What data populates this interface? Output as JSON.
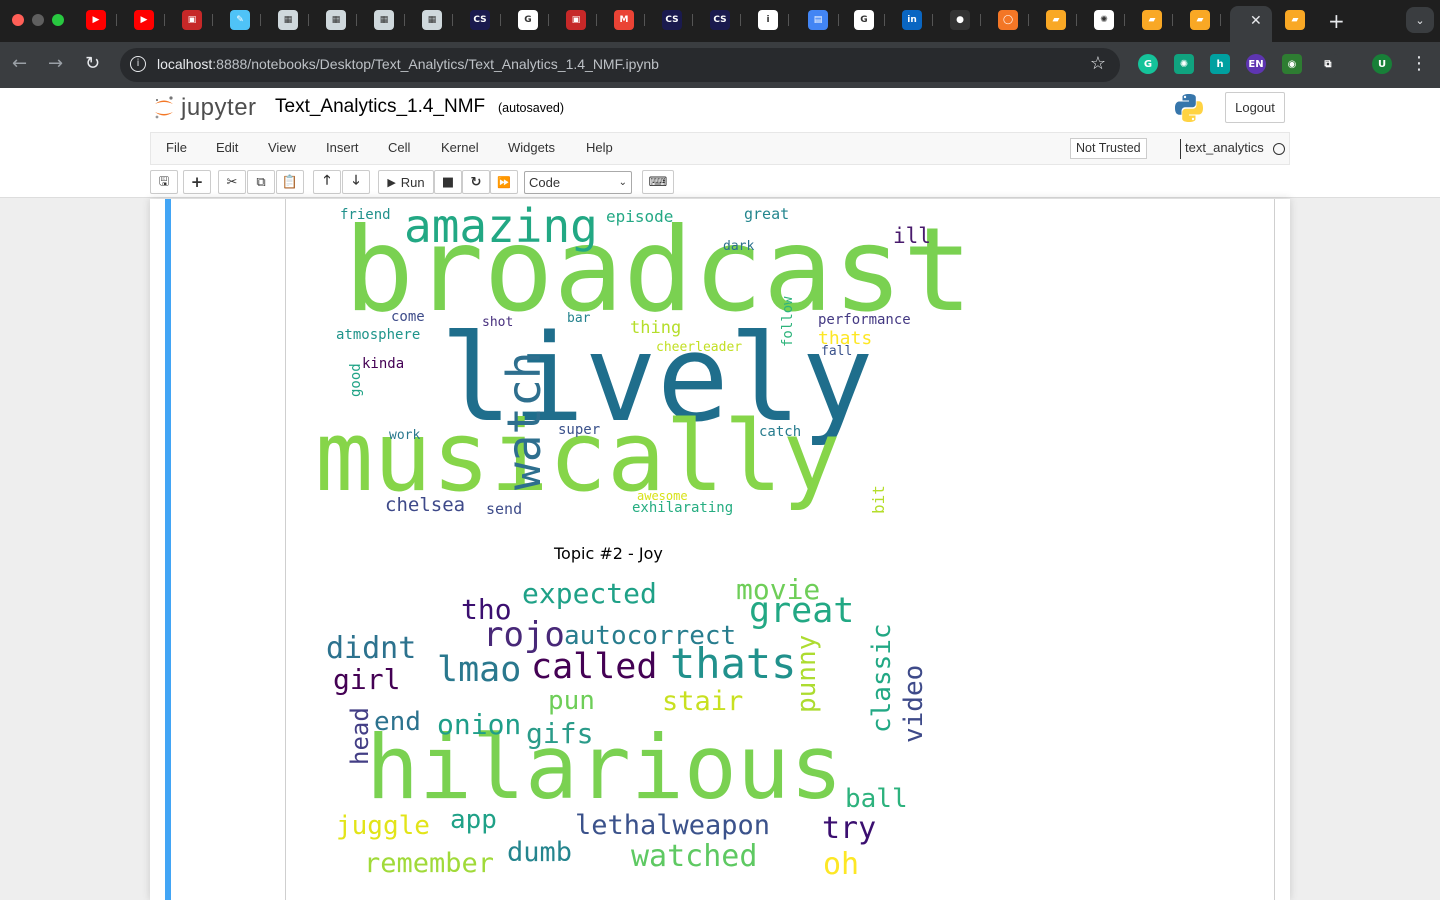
{
  "browser": {
    "tabs": [
      {
        "icon": "youtube-icon",
        "color": "#ff0000",
        "text": "▶"
      },
      {
        "icon": "youtube-icon",
        "color": "#ff0000",
        "text": "▶"
      },
      {
        "icon": "pdf-icon",
        "color": "#c62828",
        "text": "▣"
      },
      {
        "icon": "feather-icon",
        "color": "#4fc3f7",
        "text": "✎"
      },
      {
        "icon": "news-icon",
        "color": "#cfd8dc",
        "text": "▦"
      },
      {
        "icon": "news-icon",
        "color": "#cfd8dc",
        "text": "▦"
      },
      {
        "icon": "news-icon",
        "color": "#cfd8dc",
        "text": "▦"
      },
      {
        "icon": "news-icon",
        "color": "#cfd8dc",
        "text": "▦"
      },
      {
        "icon": "cs-icon",
        "color": "#1a1a4e",
        "text": "CS"
      },
      {
        "icon": "google-icon",
        "color": "#ffffff",
        "text": "G"
      },
      {
        "icon": "pdf-icon",
        "color": "#c62828",
        "text": "▣"
      },
      {
        "icon": "gmail-icon",
        "color": "#ea4335",
        "text": "M"
      },
      {
        "icon": "cs-icon",
        "color": "#1a1a4e",
        "text": "CS"
      },
      {
        "icon": "cs-icon",
        "color": "#1a1a4e",
        "text": "CS"
      },
      {
        "icon": "info-icon",
        "color": "#ffffff",
        "text": "i"
      },
      {
        "icon": "calendar-icon",
        "color": "#4285f4",
        "text": "▤"
      },
      {
        "icon": "google-icon",
        "color": "#ffffff",
        "text": "G"
      },
      {
        "icon": "linkedin-icon",
        "color": "#0a66c2",
        "text": "in"
      },
      {
        "icon": "github-icon",
        "color": "#333333",
        "text": "●"
      },
      {
        "icon": "jupyter-icon",
        "color": "#f37626",
        "text": "◯"
      },
      {
        "icon": "book-icon",
        "color": "#f9a825",
        "text": "▰"
      },
      {
        "icon": "chatgpt-icon",
        "color": "#ffffff",
        "text": "✺"
      },
      {
        "icon": "book-icon",
        "color": "#f9a825",
        "text": "▰"
      },
      {
        "icon": "book-icon",
        "color": "#f9a825",
        "text": "▰"
      },
      {
        "icon": "book-icon",
        "color": "#f9a825",
        "text": "▰"
      }
    ],
    "url_host": "localhost",
    "url_rest": ":8888/notebooks/Desktop/Text_Analytics/Text_Analytics_1.4_NMF.ipynb",
    "extensions": [
      {
        "icon": "grammarly-icon",
        "color": "#15c39a",
        "text": "G"
      },
      {
        "icon": "chatgpt-ext-icon",
        "color": "#10a37f",
        "text": "✺"
      },
      {
        "icon": "honey-icon",
        "color": "#00a0a0",
        "text": "h"
      },
      {
        "icon": "translate-icon",
        "color": "#5e35b1",
        "text": "EN"
      },
      {
        "icon": "game-icon",
        "color": "#2e7d32",
        "text": "◉"
      },
      {
        "icon": "puzzle-icon",
        "color": "#3a3d40",
        "text": "⧉"
      }
    ],
    "profile_initial": "U"
  },
  "jupyter": {
    "logo_text": "jupyter",
    "notebook_name": "Text_Analytics_1.4_NMF",
    "autosave_status": "(autosaved)",
    "logout_label": "Logout",
    "menu": [
      "File",
      "Edit",
      "View",
      "Insert",
      "Cell",
      "Kernel",
      "Widgets",
      "Help"
    ],
    "trust_label": "Not Trusted",
    "kernel_name": "text_analytics",
    "run_label": "Run",
    "cell_type": "Code"
  },
  "chart_data": [
    {
      "type": "wordcloud",
      "title": "",
      "words": [
        {
          "text": "broadcast",
          "color": "#7ad151",
          "size": 120
        },
        {
          "text": "lively",
          "color": "#1f6e8c",
          "size": 120
        },
        {
          "text": "musically",
          "color": "#86d549",
          "size": 100
        },
        {
          "text": "amazing",
          "color": "#22a884",
          "size": 48
        },
        {
          "text": "watch",
          "color": "#2e6f8e",
          "size": 46
        },
        {
          "text": "ill",
          "color": "#481a6c",
          "size": 22
        },
        {
          "text": "friend",
          "color": "#21918c",
          "size": 14
        },
        {
          "text": "episode",
          "color": "#23a884",
          "size": 16
        },
        {
          "text": "great",
          "color": "#24868e",
          "size": 15
        },
        {
          "text": "dark",
          "color": "#2d708e",
          "size": 13
        },
        {
          "text": "come",
          "color": "#3e4c8a",
          "size": 14
        },
        {
          "text": "shot",
          "color": "#472f7d",
          "size": 13
        },
        {
          "text": "bar",
          "color": "#25838e",
          "size": 13
        },
        {
          "text": "thing",
          "color": "#b5de2b",
          "size": 16
        },
        {
          "text": "follow",
          "color": "#2fb47c",
          "size": 14
        },
        {
          "text": "performance",
          "color": "#443983",
          "size": 14
        },
        {
          "text": "atmosphere",
          "color": "#1f958b",
          "size": 14
        },
        {
          "text": "cheerleader",
          "color": "#c2df23",
          "size": 13
        },
        {
          "text": "thats",
          "color": "#fde725",
          "size": 18
        },
        {
          "text": "fall",
          "color": "#3b528b",
          "size": 13
        },
        {
          "text": "kinda",
          "color": "#440154",
          "size": 14
        },
        {
          "text": "good",
          "color": "#20a386",
          "size": 14
        },
        {
          "text": "work",
          "color": "#2a788e",
          "size": 13
        },
        {
          "text": "super",
          "color": "#3b528b",
          "size": 14
        },
        {
          "text": "catch",
          "color": "#287c8e",
          "size": 14
        },
        {
          "text": "chelsea",
          "color": "#3e4989",
          "size": 18
        },
        {
          "text": "send",
          "color": "#3e4c8a",
          "size": 15
        },
        {
          "text": "awesome",
          "color": "#d8e219",
          "size": 12
        },
        {
          "text": "exhilarating",
          "color": "#26ad81",
          "size": 14
        },
        {
          "text": "bit",
          "color": "#b5de2b",
          "size": 16
        }
      ]
    },
    {
      "type": "wordcloud",
      "title": "Topic #2 - Joy",
      "words": [
        {
          "text": "hilarious",
          "color": "#7ad151",
          "size": 80
        },
        {
          "text": "thats",
          "color": "#21918c",
          "size": 40
        },
        {
          "text": "called",
          "color": "#440154",
          "size": 35
        },
        {
          "text": "lmao",
          "color": "#2a788e",
          "size": 35
        },
        {
          "text": "rojo",
          "color": "#482878",
          "size": 33
        },
        {
          "text": "great",
          "color": "#22a884",
          "size": 34
        },
        {
          "text": "movie",
          "color": "#6ece58",
          "size": 28
        },
        {
          "text": "expected",
          "color": "#1fa187",
          "size": 28
        },
        {
          "text": "tho",
          "color": "#3b0f70",
          "size": 28
        },
        {
          "text": "autocorrect",
          "color": "#287d8e",
          "size": 26
        },
        {
          "text": "didnt",
          "color": "#2c728e",
          "size": 30
        },
        {
          "text": "girl",
          "color": "#440154",
          "size": 28
        },
        {
          "text": "punny",
          "color": "#addc30",
          "size": 26
        },
        {
          "text": "classic",
          "color": "#22a884",
          "size": 26
        },
        {
          "text": "video",
          "color": "#3e4a89",
          "size": 26
        },
        {
          "text": "pun",
          "color": "#6ece58",
          "size": 26
        },
        {
          "text": "stair",
          "color": "#c8e020",
          "size": 27
        },
        {
          "text": "head",
          "color": "#433e85",
          "size": 24
        },
        {
          "text": "end",
          "color": "#2c728e",
          "size": 26
        },
        {
          "text": "onion",
          "color": "#1f9e89",
          "size": 28
        },
        {
          "text": "gifs",
          "color": "#2a9b89",
          "size": 28
        },
        {
          "text": "ball",
          "color": "#2db27d",
          "size": 26
        },
        {
          "text": "juggle",
          "color": "#e2e418",
          "size": 26
        },
        {
          "text": "app",
          "color": "#1fa187",
          "size": 26
        },
        {
          "text": "lethalweapon",
          "color": "#3b528b",
          "size": 27
        },
        {
          "text": "try",
          "color": "#3b0f70",
          "size": 30
        },
        {
          "text": "remember",
          "color": "#a0da39",
          "size": 27
        },
        {
          "text": "dumb",
          "color": "#25858e",
          "size": 27
        },
        {
          "text": "watched",
          "color": "#5ec962",
          "size": 30
        },
        {
          "text": "oh",
          "color": "#fde725",
          "size": 30
        }
      ]
    }
  ]
}
